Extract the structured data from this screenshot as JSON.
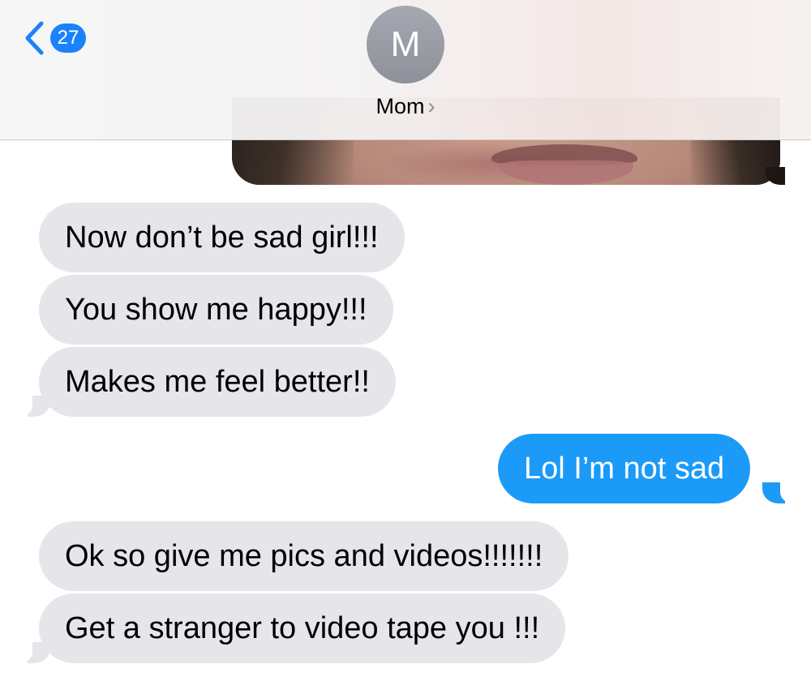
{
  "nav": {
    "back_badge": "27",
    "back_icon": "chevron-left-icon",
    "accent_color": "#1a82fb"
  },
  "contact": {
    "initial": "M",
    "name": "Mom",
    "name_chevron": "›"
  },
  "conversation": {
    "photo_message": {
      "sender": "me",
      "content": "photo"
    },
    "messages": [
      {
        "sender": "contact",
        "text": "Now don’t be sad girl!!!"
      },
      {
        "sender": "contact",
        "text": "You show me happy!!!"
      },
      {
        "sender": "contact",
        "text": "Makes me feel better!!"
      },
      {
        "sender": "me",
        "text": "Lol I’m not sad"
      },
      {
        "sender": "contact",
        "text": "Ok so give me pics and videos!!!!!!!"
      },
      {
        "sender": "contact",
        "text": "Get a stranger to video tape you !!!"
      }
    ]
  },
  "colors": {
    "incoming_bubble": "#e5e5ea",
    "outgoing_bubble": "#1c9af7",
    "avatar": "#9a9da6"
  }
}
